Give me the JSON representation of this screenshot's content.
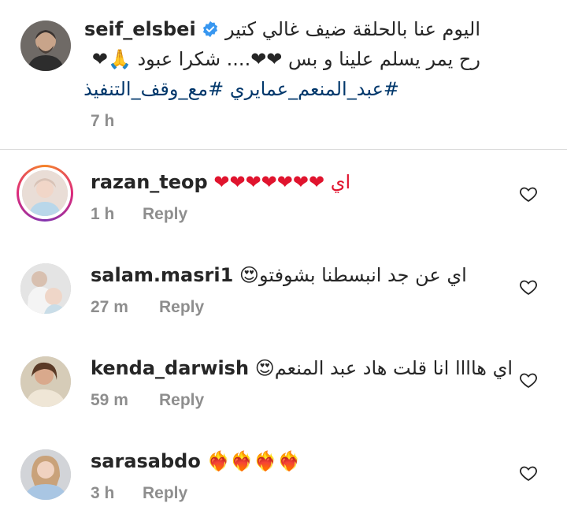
{
  "post": {
    "username": "seif_elsbei",
    "caption_line1": "اليوم عنا بالحلقة ضيف غالي كتير",
    "caption_line2": "رح يمر يسلم علينا و بس ❤❤.... شكرا عبود 🙏❤",
    "hashtags": "#عبد_المنعم_عمايري #مع_وقف_التنفيذ",
    "time": "7 h"
  },
  "comments": [
    {
      "username": "razan_teop",
      "text": "اي ❤❤❤❤❤❤❤",
      "time": "1 h",
      "reply": "Reply"
    },
    {
      "username": "salam.masri1",
      "text": "اي عن جد انبسطنا بشوفتو😍",
      "time": "27 m",
      "reply": "Reply"
    },
    {
      "username": "kenda_darwish",
      "text": "اي هاااا انا قلت هاد عبد المنعم😍",
      "time": "59 m",
      "reply": "Reply"
    },
    {
      "username": "sarasabdo",
      "text": "❤‍🔥❤‍🔥❤‍🔥❤‍🔥",
      "time": "3 h",
      "reply": "Reply"
    }
  ],
  "icons": {
    "verified": "verified-badge-icon",
    "like": "heart-outline-icon"
  },
  "colors": {
    "username": "#262626",
    "meta": "#8e8e8e",
    "hashtag": "#00376b",
    "verified": "#3897f0",
    "divider": "#dbdbdb"
  }
}
